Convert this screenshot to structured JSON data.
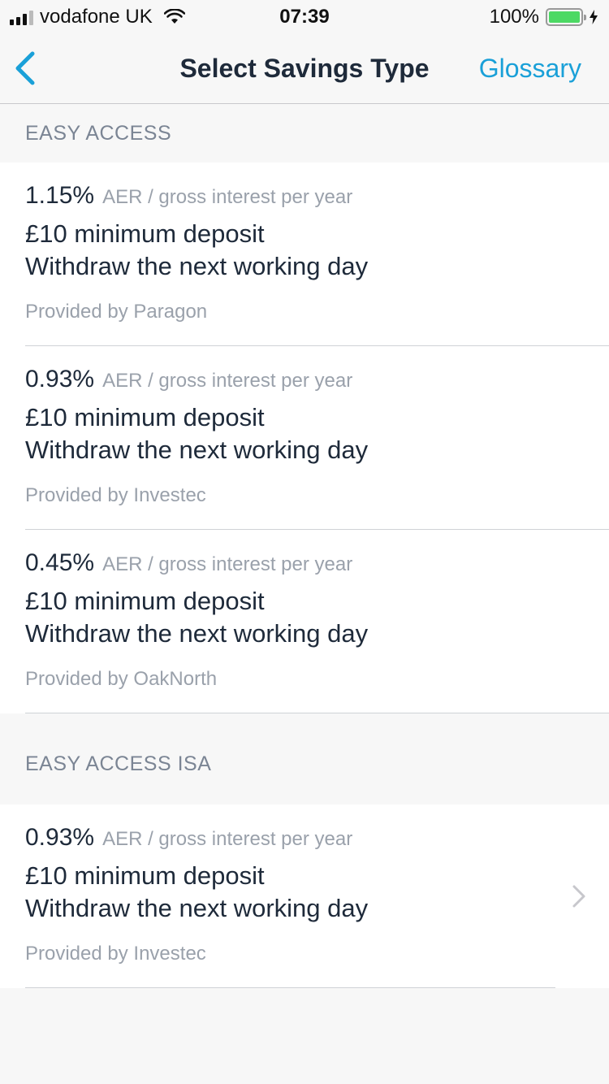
{
  "status_bar": {
    "carrier": "vodafone UK",
    "time": "07:39",
    "battery": "100%"
  },
  "nav": {
    "title": "Select Savings Type",
    "glossary_label": "Glossary"
  },
  "sections": [
    {
      "header": "EASY ACCESS",
      "items": [
        {
          "rate": "1.15%",
          "rate_desc": "AER / gross interest per year",
          "line1": "£10 minimum deposit",
          "line2": "Withdraw the next working day",
          "provider": "Provided by Paragon"
        },
        {
          "rate": "0.93%",
          "rate_desc": "AER / gross interest per year",
          "line1": "£10 minimum deposit",
          "line2": "Withdraw the next working day",
          "provider": "Provided by Investec"
        },
        {
          "rate": "0.45%",
          "rate_desc": "AER / gross interest per year",
          "line1": "£10 minimum deposit",
          "line2": "Withdraw the next working day",
          "provider": "Provided by OakNorth"
        }
      ]
    },
    {
      "header": "EASY ACCESS ISA",
      "items": [
        {
          "rate": "0.93%",
          "rate_desc": "AER / gross interest per year",
          "line1": "£10 minimum deposit",
          "line2": "Withdraw the next working day",
          "provider": "Provided by Investec"
        }
      ]
    }
  ],
  "colors": {
    "accent": "#1aa0d8",
    "text": "#1e2a3a",
    "muted": "#9aa1ab",
    "battery": "#4cd964"
  },
  "icons": [
    "signal-icon",
    "wifi-icon",
    "battery-icon",
    "charging-bolt-icon",
    "back-chevron-icon",
    "chevron-right-icon"
  ]
}
